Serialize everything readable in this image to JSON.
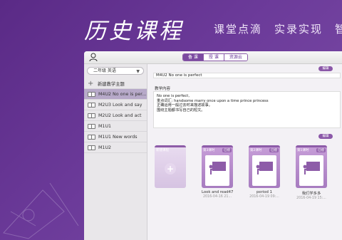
{
  "banner": {
    "title": "历史课程",
    "subtitle": "课堂点滴　实录实现　智"
  },
  "background_number": "22",
  "topbar": {
    "segments": [
      {
        "label": "备 课",
        "active": true
      },
      {
        "label": "授 课",
        "active": false
      },
      {
        "label": "资源云",
        "active": false
      }
    ]
  },
  "sidebar": {
    "grade_select": "二年级 英语",
    "add_label": "新建教学主题",
    "items": [
      {
        "label": "M4U2 No one is per...",
        "selected": true
      },
      {
        "label": "M2U3 Look and say",
        "selected": false
      },
      {
        "label": "M2U2 Look and act",
        "selected": false
      },
      {
        "label": "M1U1",
        "selected": false
      },
      {
        "label": "M1U1 New words",
        "selected": false
      },
      {
        "label": "M1U2",
        "selected": false
      }
    ]
  },
  "main": {
    "edit_label": "编辑",
    "title_value": "M4U2 No one is perfect",
    "content_label": "教学内容",
    "content_lines": [
      "No one is perfect,",
      "重点词汇:    handsome    marry      once upon a time      prince        princess",
      "正确运用一般过去时来描述故事。",
      "围绕主题都书写自己的短文。"
    ],
    "edit2_label": "编辑",
    "cards": [
      {
        "tag": "新建课程",
        "tag2": "",
        "title": "",
        "date": "",
        "new": true
      },
      {
        "tag": "第3课时",
        "tag2": "已授",
        "title": "Look and read47",
        "date": "2016-04-16 21...",
        "new": false
      },
      {
        "tag": "第2课时",
        "tag2": "已授",
        "title": "period 1",
        "date": "2016-04-19 09:...",
        "new": false
      },
      {
        "tag": "第1课时",
        "tag2": "已授",
        "title": "我们学多多",
        "date": "2016-04-19 15:...",
        "new": false
      }
    ]
  },
  "colors": {
    "brand": "#6b3a99",
    "accent": "#8b58a8",
    "selected_row": "#b7a9c9"
  }
}
